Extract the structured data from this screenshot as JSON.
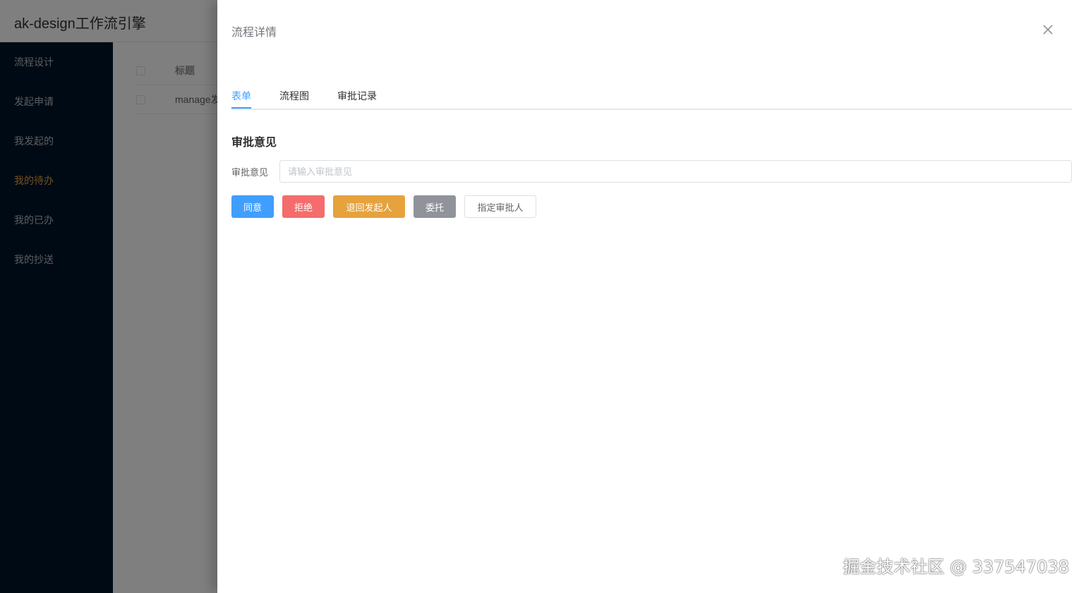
{
  "app": {
    "title": "ak-design工作流引擎"
  },
  "sidebar": {
    "items": [
      {
        "label": "流程设计"
      },
      {
        "label": "发起申请"
      },
      {
        "label": "我发起的"
      },
      {
        "label": "我的待办"
      },
      {
        "label": "我的已办"
      },
      {
        "label": "我的抄送"
      }
    ],
    "active_color": "#e6a23c"
  },
  "table": {
    "header": "标题",
    "rows": [
      "manage发"
    ]
  },
  "drawer": {
    "title": "流程详情",
    "close_icon": "close-icon",
    "tabs": [
      {
        "label": "表单"
      },
      {
        "label": "流程图"
      },
      {
        "label": "审批记录"
      }
    ],
    "section_title": "审批意见",
    "field_label": "审批意见",
    "field_placeholder": "请输入审批意见",
    "field_value": "",
    "buttons": {
      "approve": "同意",
      "reject": "拒绝",
      "return": "退回发起人",
      "delegate": "委托",
      "assign": "指定审批人"
    }
  },
  "watermark": "掘金技术社区 @ 337547038",
  "colors": {
    "primary": "#409eff",
    "danger": "#f56c6c",
    "warning": "#e6a23c",
    "info": "#909399",
    "sidebar_bg": "#001529"
  }
}
